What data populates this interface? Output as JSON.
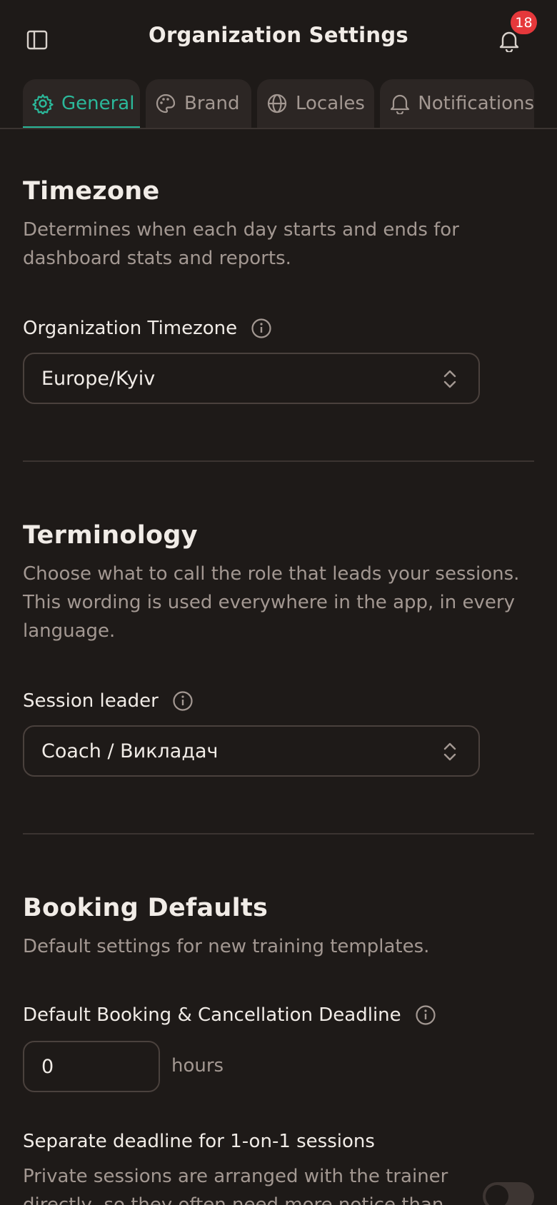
{
  "header": {
    "title": "Organization Settings",
    "notification_count": "18"
  },
  "tabs": [
    {
      "label": "General",
      "icon": "gear-icon",
      "active": true
    },
    {
      "label": "Brand",
      "icon": "palette-icon",
      "active": false
    },
    {
      "label": "Locales",
      "icon": "globe-icon",
      "active": false
    },
    {
      "label": "Notifications",
      "icon": "bell-icon",
      "active": false
    }
  ],
  "timezone": {
    "title": "Timezone",
    "description": "Determines when each day starts and ends for dashboard stats and reports.",
    "field_label": "Organization Timezone",
    "value": "Europe/Kyiv"
  },
  "terminology": {
    "title": "Terminology",
    "description": "Choose what to call the role that leads your sessions. This wording is used everywhere in the app, in every language.",
    "field_label": "Session leader",
    "value": "Coach / Викладач"
  },
  "booking": {
    "title": "Booking Defaults",
    "description": "Default settings for new training templates.",
    "deadline_label": "Default Booking & Cancellation Deadline",
    "deadline_value": "0",
    "deadline_unit": "hours",
    "separate_label": "Separate deadline for 1-on-1 sessions",
    "separate_description": "Private sessions are arranged with the trainer directly, so they often need more notice than",
    "separate_enabled": false
  },
  "colors": {
    "background": "#1e1a18",
    "accent": "#2bb89a",
    "badge": "#e5383b",
    "muted_text": "#a39892"
  }
}
